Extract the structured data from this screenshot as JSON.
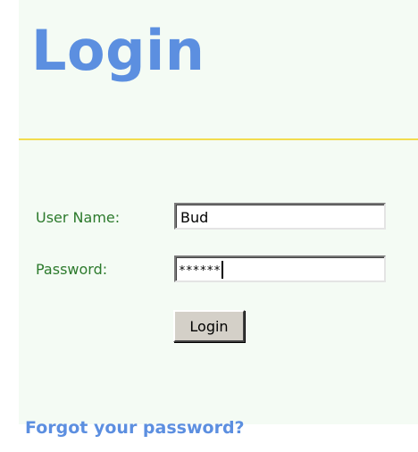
{
  "page": {
    "title": "Login"
  },
  "form": {
    "username": {
      "label": "User Name:",
      "value": "Bud"
    },
    "password": {
      "label": "Password:",
      "masked_value": "******"
    },
    "submit_label": "Login"
  },
  "links": {
    "forgot_password": "Forgot your password?"
  },
  "colors": {
    "title_blue": "#5c8fe0",
    "label_green": "#2c7a2c",
    "divider_yellow": "#f2dc4f",
    "panel_background": "#f4fbf4"
  }
}
